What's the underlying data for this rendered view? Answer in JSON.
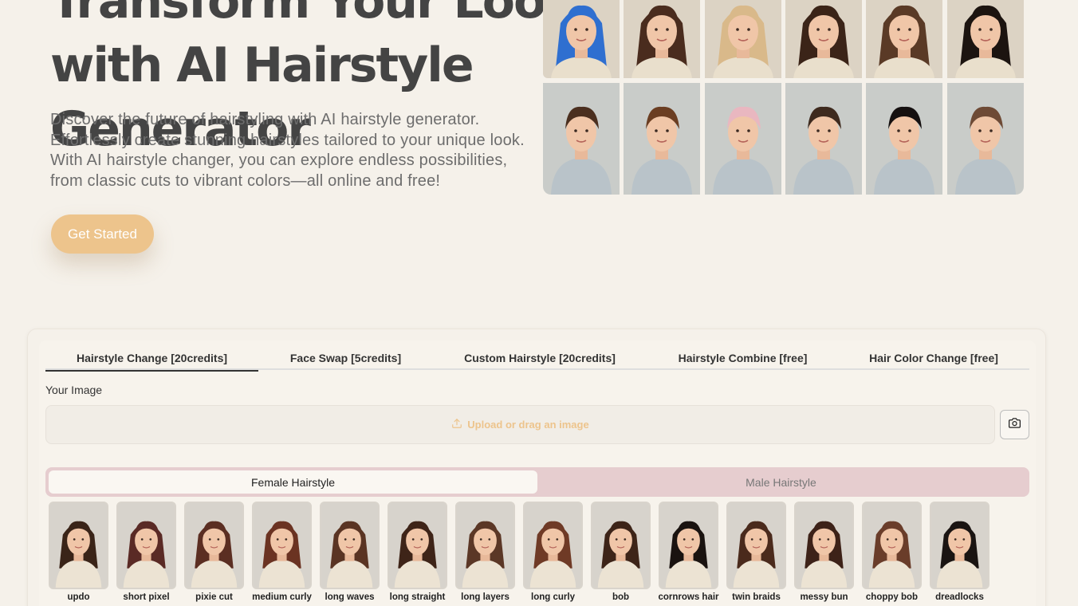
{
  "hero": {
    "title_lines": [
      "Transform Your Look",
      "with AI Hairstyle",
      "Generator"
    ],
    "description": "Discover the future of hairstyling with AI hairstyle generator. Effortlessly create stunning hairstyles tailored to your unique look. With AI hairstyle changer, you can explore endless possibilities, from classic cuts to vibrant colors—all online and free!",
    "cta_label": "Get Started"
  },
  "gallery": {
    "female_row": [
      {
        "name": "blue-bob",
        "hair": "#2f6fd0"
      },
      {
        "name": "dark-bob",
        "hair": "#4a2c1e"
      },
      {
        "name": "blonde-waves",
        "hair": "#d9b98a"
      },
      {
        "name": "curly-updo",
        "hair": "#3b2418"
      },
      {
        "name": "messy-waves",
        "hair": "#5a3a26"
      },
      {
        "name": "black-braids",
        "hair": "#1c1410"
      }
    ],
    "male_row": [
      {
        "name": "short-brown",
        "hair": "#4b2f1f"
      },
      {
        "name": "curly-brown",
        "hair": "#6b3e22"
      },
      {
        "name": "pink-quiff",
        "hair": "#e9b7c0"
      },
      {
        "name": "textured-crop",
        "hair": "#3e2a1e"
      },
      {
        "name": "black-afro",
        "hair": "#151010"
      },
      {
        "name": "pompadour",
        "hair": "#6e4a35"
      }
    ]
  },
  "tool": {
    "tabs": [
      {
        "label": "Hairstyle Change [20credits]",
        "active": true
      },
      {
        "label": "Face Swap [5credits]",
        "active": false
      },
      {
        "label": "Custom Hairstyle [20credits]",
        "active": false
      },
      {
        "label": "Hairstyle Combine [free]",
        "active": false
      },
      {
        "label": "Hair Color Change [free]",
        "active": false
      }
    ],
    "your_image_label": "Your Image",
    "upload_text": "Upload or drag an image",
    "segment": {
      "female": "Female Hairstyle",
      "male": "Male Hairstyle",
      "selected": "female"
    },
    "styles": [
      {
        "label": "updo",
        "hair": "#3a2418"
      },
      {
        "label": "short pixel",
        "hair": "#5a2a25"
      },
      {
        "label": "pixie cut",
        "hair": "#5b2e22"
      },
      {
        "label": "medium curly",
        "hair": "#6b3322"
      },
      {
        "label": "long waves",
        "hair": "#5a3423"
      },
      {
        "label": "long straight",
        "hair": "#3e2418"
      },
      {
        "label": "long layers",
        "hair": "#5b3726"
      },
      {
        "label": "long curly",
        "hair": "#6f3a26"
      },
      {
        "label": "bob",
        "hair": "#3d2418"
      },
      {
        "label": "cornrows hair",
        "hair": "#1a1310"
      },
      {
        "label": "twin braids",
        "hair": "#4a2a1c"
      },
      {
        "label": "messy bun",
        "hair": "#3d2218"
      },
      {
        "label": "choppy bob",
        "hair": "#6a3d2a"
      },
      {
        "label": "dreadlocks",
        "hair": "#1a1412"
      }
    ]
  },
  "colors": {
    "background": "#f5f1ea",
    "accent": "#edc48c",
    "segment_bg": "#e6cdcf"
  }
}
